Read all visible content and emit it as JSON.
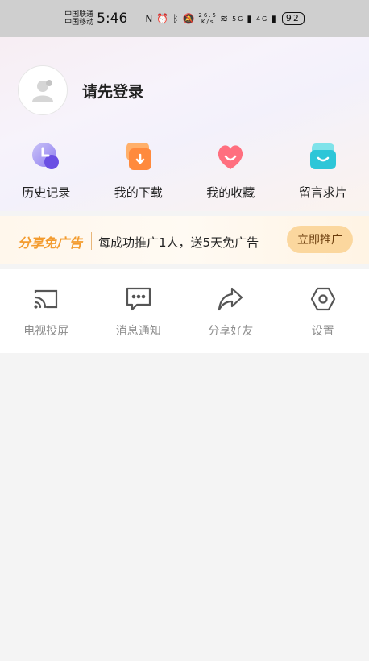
{
  "status_bar": {
    "carrier1": "中国联通",
    "carrier2": "中国移动",
    "time": "5:46",
    "speed_value": "26.5",
    "speed_unit": "K/s",
    "signal1": "5G",
    "signal2": "4G",
    "battery": "92"
  },
  "profile": {
    "login_prompt": "请先登录"
  },
  "quick_actions": [
    {
      "label": "历史记录",
      "icon": "history-icon"
    },
    {
      "label": "我的下载",
      "icon": "download-icon"
    },
    {
      "label": "我的收藏",
      "icon": "heart-icon"
    },
    {
      "label": "留言求片",
      "icon": "message-box-icon"
    }
  ],
  "promo": {
    "title": "分享免广告",
    "description": "每成功推广1人，送5天免广告",
    "button": "立即推广"
  },
  "tools": [
    {
      "label": "电视投屏",
      "icon": "cast-icon"
    },
    {
      "label": "消息通知",
      "icon": "chat-icon"
    },
    {
      "label": "分享好友",
      "icon": "share-icon"
    },
    {
      "label": "设置",
      "icon": "settings-icon"
    }
  ]
}
